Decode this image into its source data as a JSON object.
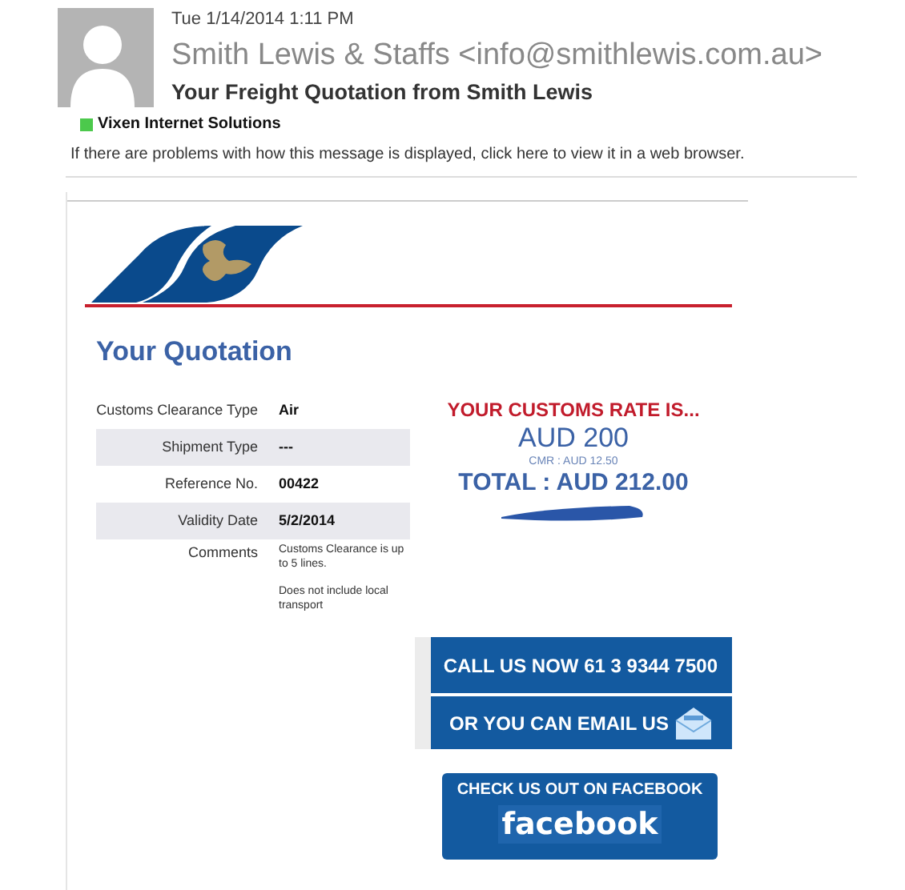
{
  "email": {
    "date": "Tue 1/14/2014 1:11 PM",
    "sender": "Smith Lewis & Staffs <info@smithlewis.com.au>",
    "subject": "Your Freight Quotation from Smith Lewis",
    "category": {
      "name": "Vixen Internet Solutions",
      "color": "#4cc94c"
    },
    "info_bar": "If there are problems with how this message is displayed, click here to view it in a web browser."
  },
  "quotation": {
    "heading": "Your Quotation",
    "rows": [
      {
        "kind": "field",
        "label": "Customs Clearance Type",
        "value": "Air"
      },
      {
        "kind": "field",
        "label": "Shipment Type",
        "value": "---"
      },
      {
        "kind": "field",
        "label": "Reference No.",
        "value": "00422"
      },
      {
        "kind": "field",
        "label": "Validity Date",
        "value": "5/2/2014"
      },
      {
        "kind": "comment",
        "label": "Comments",
        "paragraphs": [
          "Customs Clearance is up to 5 lines.",
          "Does not include local transport"
        ]
      }
    ]
  },
  "rate": {
    "heading": "YOUR CUSTOMS RATE IS...",
    "amount": "AUD 200",
    "cmr": "CMR : AUD 12.50",
    "total": "TOTAL : AUD 212.00"
  },
  "contact": {
    "call": "CALL US NOW 61 3 9344 7500",
    "email": "OR YOU CAN EMAIL US"
  },
  "facebook": {
    "caption": "CHECK US OUT ON FACEBOOK",
    "logo": "facebook"
  }
}
